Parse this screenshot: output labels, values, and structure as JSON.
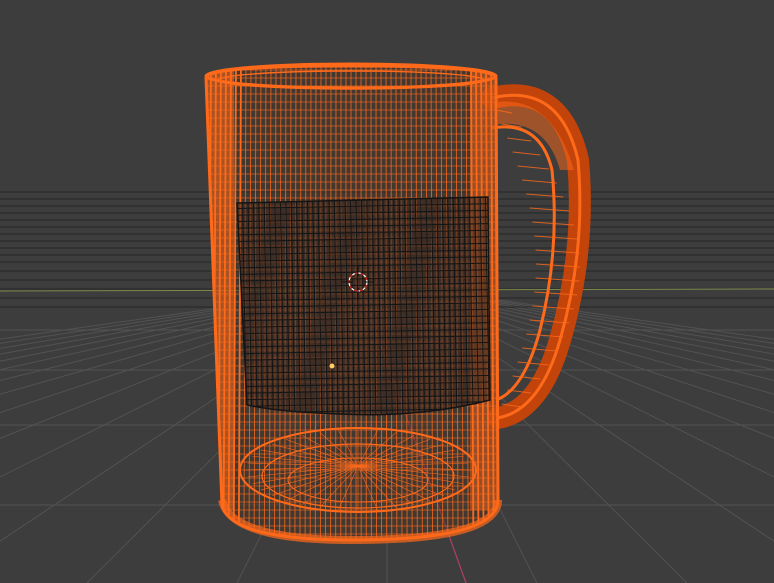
{
  "viewport": {
    "background_color": "#3d3d3d",
    "grid_color": "#525252",
    "horizon_line_color": "#1e1e1e",
    "x_axis_color": "#7a8a4a",
    "z_axis_color": "#b04060"
  },
  "mesh": {
    "object_type": "mug",
    "display_mode": "wireframe",
    "selected": true,
    "wire_color": "#ff6a1a",
    "wire_shadow_color": "#c2440a",
    "selected_face_wire_color": "#141414"
  },
  "gizmos": {
    "origin_icon": "origin-dot-icon",
    "cursor_icon": "3d-cursor-icon",
    "light_icon": "light-dot-icon"
  }
}
